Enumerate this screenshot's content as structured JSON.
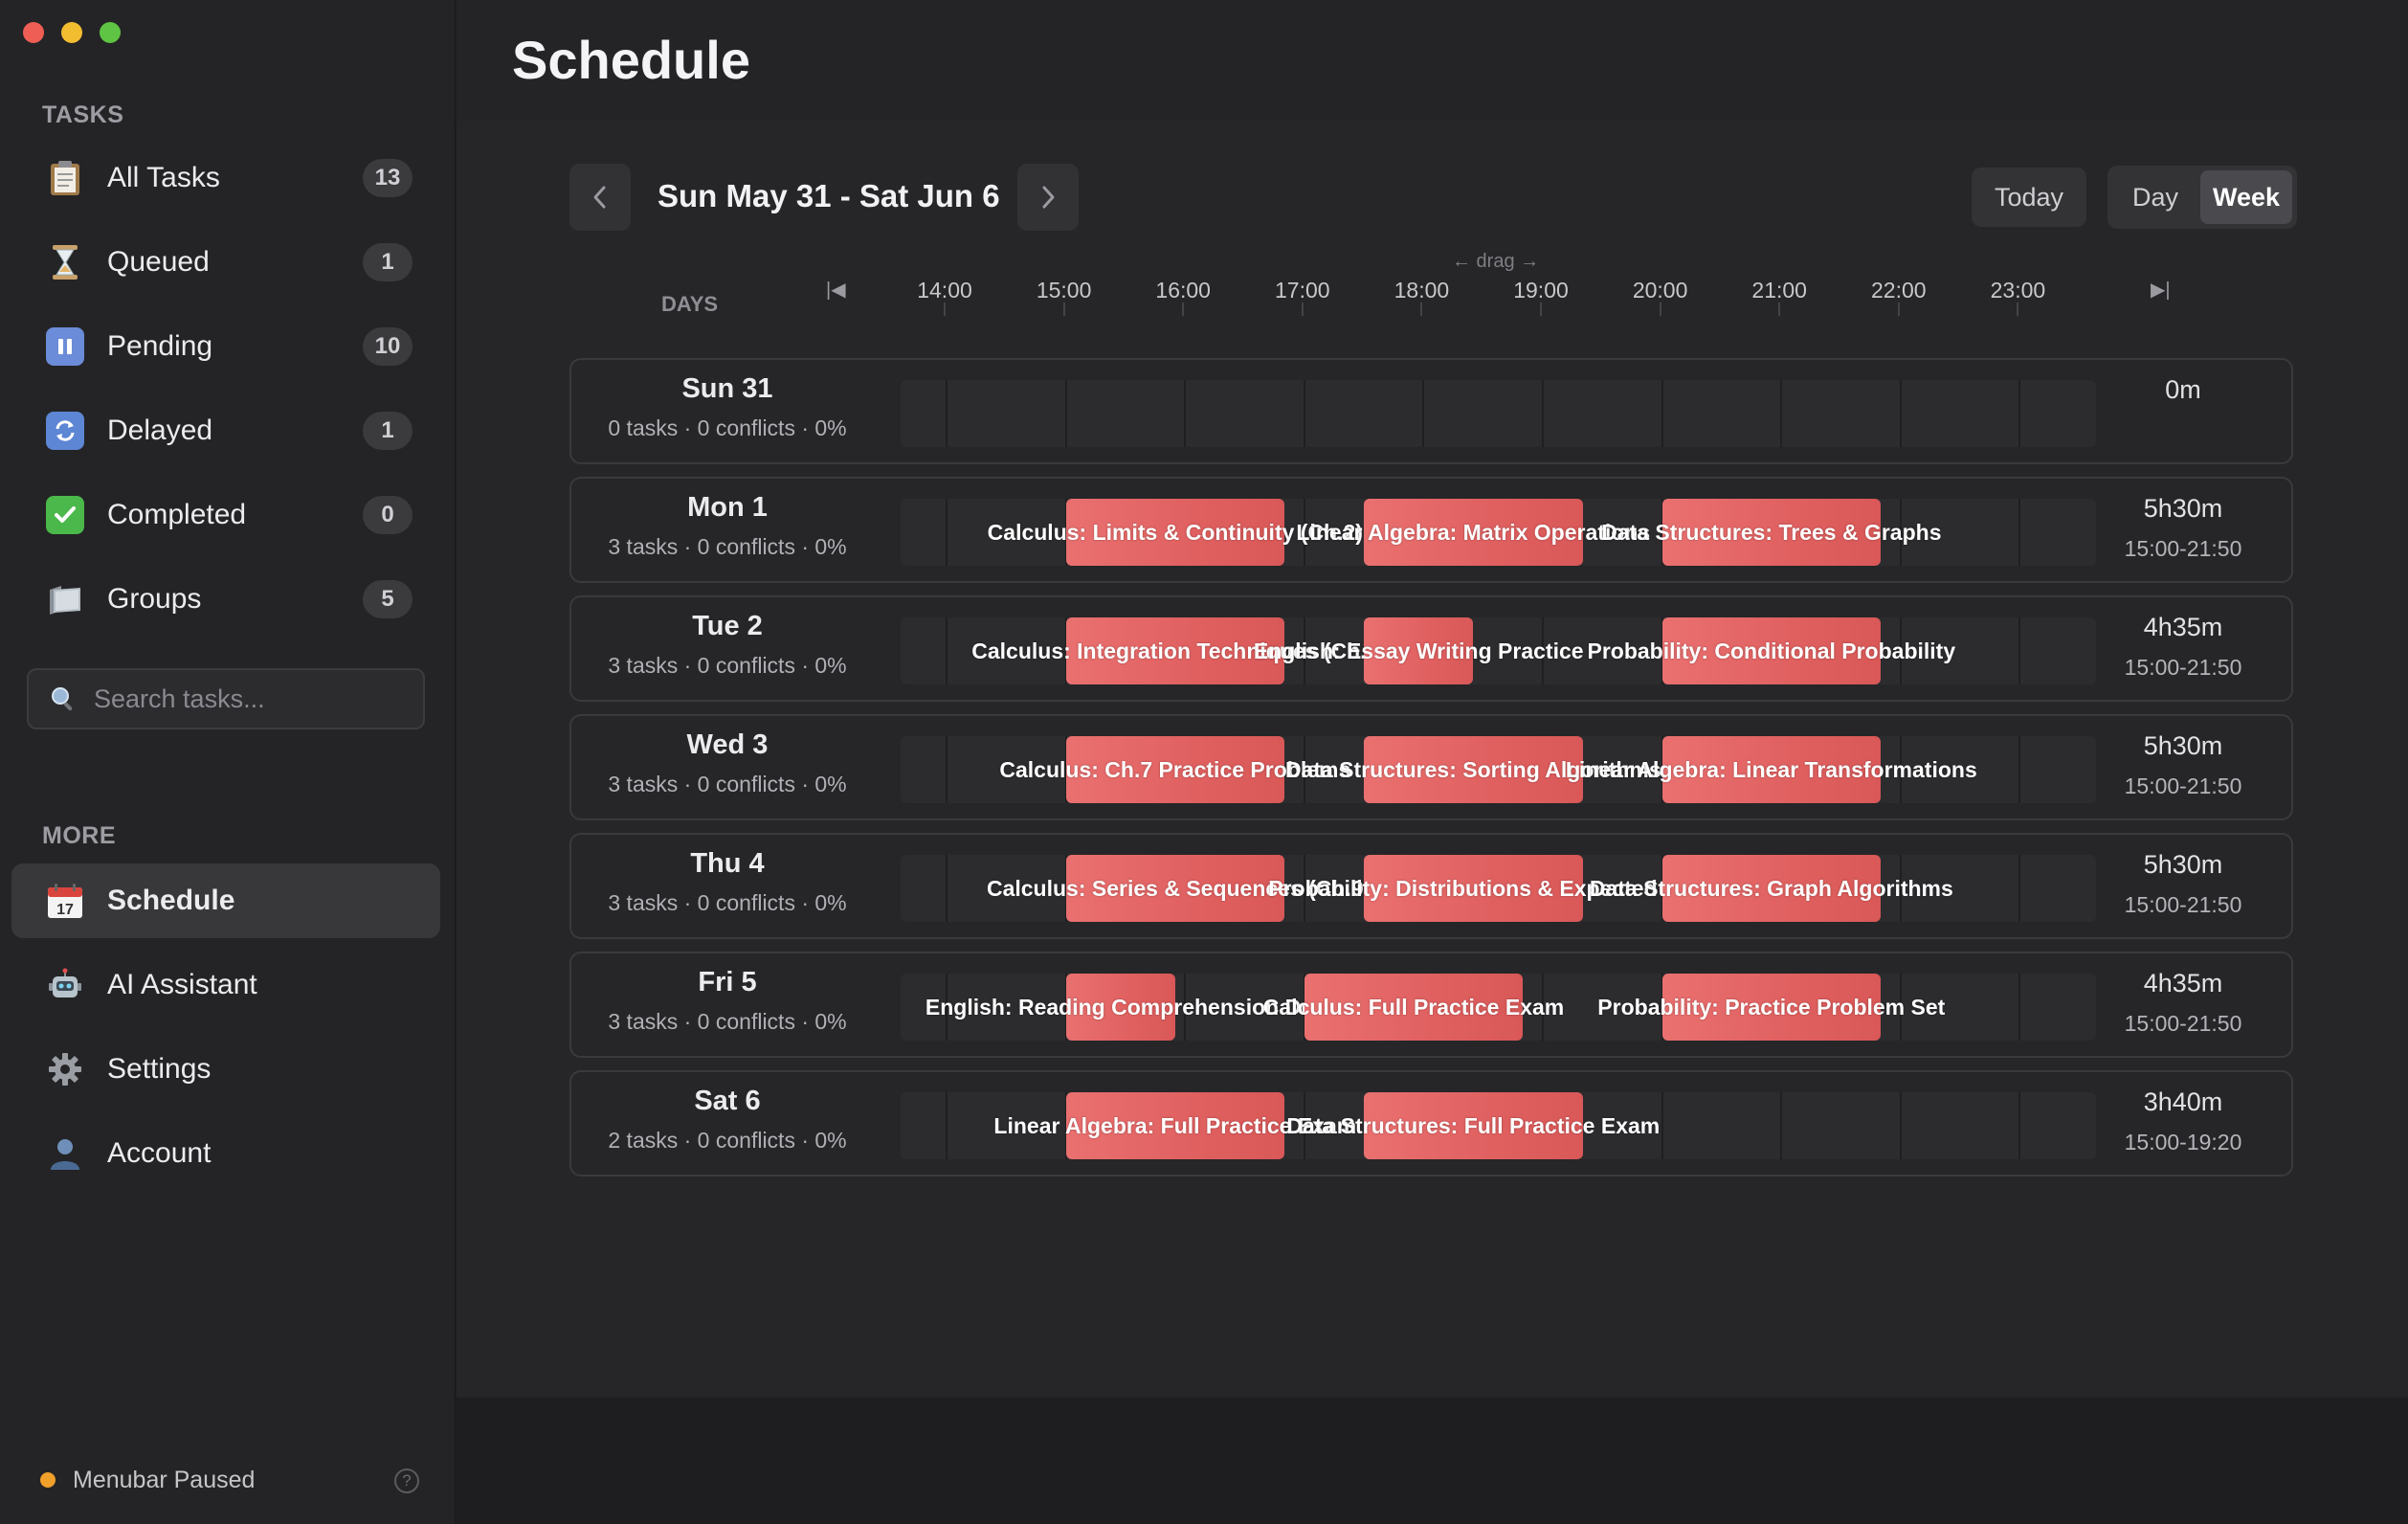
{
  "sidebar": {
    "tasks_heading": "TASKS",
    "items": [
      {
        "label": "All Tasks",
        "badge": "13",
        "icon": "clipboard-icon"
      },
      {
        "label": "Queued",
        "badge": "1",
        "icon": "hourglass-icon"
      },
      {
        "label": "Pending",
        "badge": "10",
        "icon": "pause-icon"
      },
      {
        "label": "Delayed",
        "badge": "1",
        "icon": "refresh-icon"
      },
      {
        "label": "Completed",
        "badge": "0",
        "icon": "checkmark-icon"
      },
      {
        "label": "Groups",
        "badge": "5",
        "icon": "folder-icon"
      }
    ],
    "search_placeholder": "Search tasks...",
    "more_heading": "MORE",
    "more_items": [
      {
        "label": "Schedule",
        "icon": "calendar-icon",
        "active": true
      },
      {
        "label": "AI Assistant",
        "icon": "robot-icon"
      },
      {
        "label": "Settings",
        "icon": "gear-icon"
      },
      {
        "label": "Account",
        "icon": "person-icon"
      }
    ],
    "status": "Menubar Paused",
    "help": "?"
  },
  "header": {
    "title": "Schedule"
  },
  "toolbar": {
    "range": "Sun May 31 - Sat Jun 6",
    "today": "Today",
    "day": "Day",
    "week": "Week",
    "prev": "‹",
    "next": "›"
  },
  "timeline": {
    "days_label": "DAYS",
    "drag_hint": "← drag →",
    "start_marker": "|◀",
    "end_marker": "▶|",
    "hours": [
      "14:00",
      "15:00",
      "16:00",
      "17:00",
      "18:00",
      "19:00",
      "20:00",
      "21:00",
      "22:00",
      "23:00"
    ]
  },
  "days": [
    {
      "name": "Sun 31",
      "meta": "0 tasks · 0 conflicts · 0%",
      "total": "0m",
      "range": "",
      "blocks": []
    },
    {
      "name": "Mon 1",
      "meta": "3 tasks · 0 conflicts · 0%",
      "total": "5h30m",
      "range": "15:00-21:50",
      "blocks": [
        {
          "label": "Calculus: Limits & Continuity (Ch.2)",
          "start": "15:00",
          "end": "16:50"
        },
        {
          "label": "Linear Algebra: Matrix Operations",
          "start": "17:30",
          "end": "19:20"
        },
        {
          "label": "Data Structures: Trees & Graphs",
          "start": "20:00",
          "end": "21:50"
        }
      ]
    },
    {
      "name": "Tue 2",
      "meta": "3 tasks · 0 conflicts · 0%",
      "total": "4h35m",
      "range": "15:00-21:50",
      "blocks": [
        {
          "label": "Calculus: Integration Techniques (Ch.5",
          "start": "15:00",
          "end": "16:50"
        },
        {
          "label": "English: Essay Writing Practice",
          "start": "17:30",
          "end": "18:25"
        },
        {
          "label": "Probability: Conditional Probability",
          "start": "20:00",
          "end": "21:50"
        }
      ]
    },
    {
      "name": "Wed 3",
      "meta": "3 tasks · 0 conflicts · 0%",
      "total": "5h30m",
      "range": "15:00-21:50",
      "blocks": [
        {
          "label": "Calculus: Ch.7 Practice Problems",
          "start": "15:00",
          "end": "16:50"
        },
        {
          "label": "Data Structures: Sorting Algorithms",
          "start": "17:30",
          "end": "19:20"
        },
        {
          "label": "Linear Algebra: Linear Transformations",
          "start": "20:00",
          "end": "21:50"
        }
      ]
    },
    {
      "name": "Thu 4",
      "meta": "3 tasks · 0 conflicts · 0%",
      "total": "5h30m",
      "range": "15:00-21:50",
      "blocks": [
        {
          "label": "Calculus: Series & Sequences (Ch.9",
          "start": "15:00",
          "end": "16:50"
        },
        {
          "label": "Probability: Distributions & Expected V",
          "start": "17:30",
          "end": "19:20"
        },
        {
          "label": "Data Structures: Graph Algorithms",
          "start": "20:00",
          "end": "21:50"
        }
      ]
    },
    {
      "name": "Fri 5",
      "meta": "3 tasks · 0 conflicts · 0%",
      "total": "4h35m",
      "range": "15:00-21:50",
      "blocks": [
        {
          "label": "English: Reading Comprehension Dri",
          "start": "15:00",
          "end": "15:55"
        },
        {
          "label": "Calculus: Full Practice Exam",
          "start": "17:00",
          "end": "18:50"
        },
        {
          "label": "Probability: Practice Problem Set",
          "start": "20:00",
          "end": "21:50"
        }
      ]
    },
    {
      "name": "Sat 6",
      "meta": "2 tasks · 0 conflicts · 0%",
      "total": "3h40m",
      "range": "15:00-19:20",
      "blocks": [
        {
          "label": "Linear Algebra: Full Practice Exam",
          "start": "15:00",
          "end": "16:50"
        },
        {
          "label": "Data Structures: Full Practice Exam",
          "start": "17:30",
          "end": "19:20"
        }
      ]
    }
  ],
  "colors": {
    "block": "#e06060",
    "status_dot": "#f0a02a"
  }
}
